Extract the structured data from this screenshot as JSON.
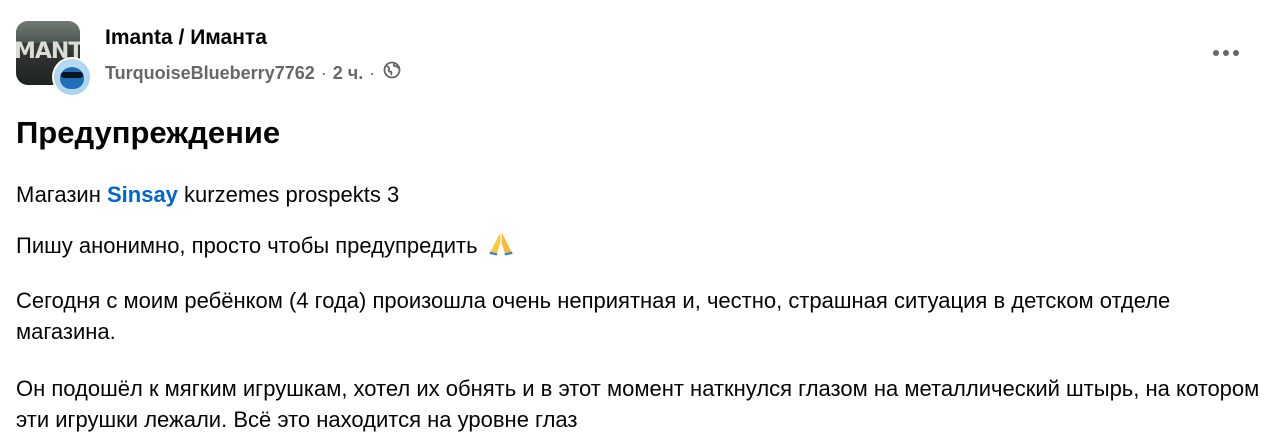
{
  "header": {
    "group_avatar_logo_text": "MANTA",
    "group_name": "Imanta / Иманта",
    "author_name": "TurquoiseBlueberry7762",
    "separator": "·",
    "time_ago": "2 ч.",
    "privacy_icon": "globe-icon",
    "more_icon": "more-horizontal-icon"
  },
  "post": {
    "title": "Предупреждение",
    "p1": {
      "before": "Магазин ",
      "link": "Sinsay",
      "after": " kurzemes prospekts 3"
    },
    "p2": {
      "text": "Пишу анонимно, просто чтобы предупредить",
      "emoji": "folded-hands-emoji"
    },
    "p3": "Сегодня с моим ребёнком (4 года) произошла очень неприятная и, честно, страшная ситуация в детском отделе магазина.",
    "p4": "Он подошёл к мягким игрушкам, хотел их обнять и в этот момент наткнулся глазом на металлический штырь, на котором эти игрушки лежали. Всё это находится на уровне глаз"
  },
  "colors": {
    "link": "#0064d1",
    "meta": "#65676b",
    "text": "#050505"
  }
}
